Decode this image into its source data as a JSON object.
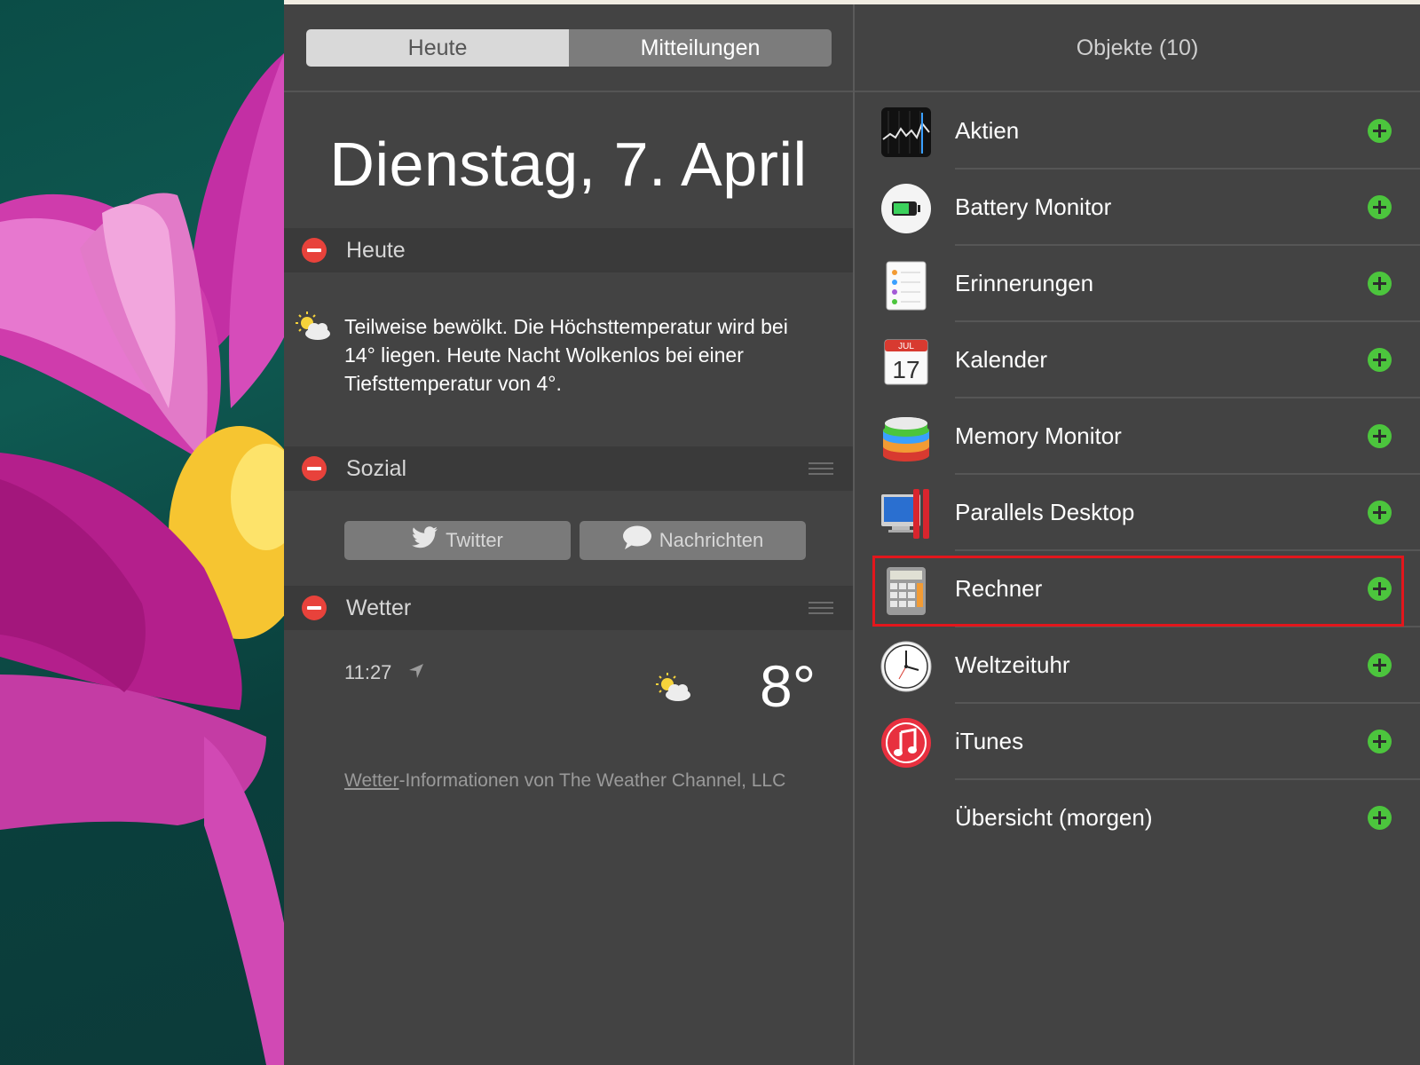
{
  "tabs": {
    "today": "Heute",
    "notifications": "Mitteilungen"
  },
  "date_heading": "Dienstag, 7. April",
  "sections": {
    "heute": {
      "title": "Heute",
      "text": "Teilweise bewölkt. Die Höchsttemperatur wird bei 14° liegen. Heute Nacht Wolkenlos bei einer Tiefsttemperatur von 4°."
    },
    "sozial": {
      "title": "Sozial",
      "twitter": "Twitter",
      "messages": "Nachrichten"
    },
    "wetter": {
      "title": "Wetter",
      "time": "11:27",
      "temperature": "8°",
      "credit_link": "Wetter",
      "credit_rest": "-Informationen von The Weather Channel, LLC"
    }
  },
  "objects_title": "Objekte (10)",
  "objects": [
    {
      "label": "Aktien",
      "icon": "stocks-icon"
    },
    {
      "label": "Battery Monitor",
      "icon": "battery-icon"
    },
    {
      "label": "Erinnerungen",
      "icon": "reminders-icon"
    },
    {
      "label": "Kalender",
      "icon": "calendar-icon",
      "icon_text": {
        "month": "JUL",
        "day": "17"
      }
    },
    {
      "label": "Memory Monitor",
      "icon": "memory-monitor-icon"
    },
    {
      "label": "Parallels Desktop",
      "icon": "parallels-icon"
    },
    {
      "label": "Rechner",
      "icon": "calculator-icon",
      "highlighted": true
    },
    {
      "label": "Weltzeituhr",
      "icon": "world-clock-icon"
    },
    {
      "label": "iTunes",
      "icon": "itunes-icon"
    },
    {
      "label": "Übersicht (morgen)",
      "icon": ""
    }
  ],
  "colors": {
    "remove": "#e8423b",
    "add": "#4cc53d",
    "highlight": "#e3161c"
  }
}
